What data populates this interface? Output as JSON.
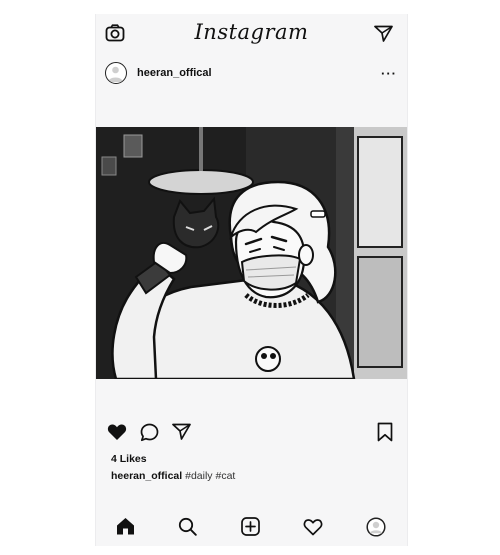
{
  "app": {
    "logo_text": "Instagram"
  },
  "topbar": {
    "camera_icon": "camera-icon",
    "send_icon": "paper-plane-icon"
  },
  "post": {
    "username": "heeran_offical",
    "more_label": "···",
    "image": {
      "description_icon": "cartoon-girl-with-cat-toy",
      "colors": {
        "background": "#2c2c2c",
        "skin": "#f4f4f4",
        "outline": "#111111"
      }
    },
    "actions": {
      "like_icon": "heart-filled-icon",
      "comment_icon": "comment-icon",
      "share_icon": "paper-plane-icon",
      "save_icon": "bookmark-icon"
    },
    "likes": "4 Likes",
    "caption": {
      "username": "heeran_offical",
      "tags": "#daily #cat"
    }
  },
  "bottom_nav": {
    "items": [
      "home-icon",
      "search-icon",
      "add-post-icon",
      "heart-outline-icon",
      "profile-icon"
    ]
  }
}
